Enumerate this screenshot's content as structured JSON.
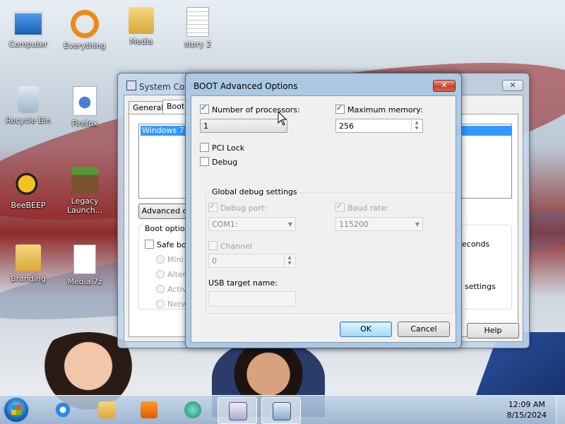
{
  "desktop": {
    "icons": [
      {
        "label": "Computer",
        "icon": "computer-icon"
      },
      {
        "label": "Everything",
        "icon": "everything-icon"
      },
      {
        "label": "Media",
        "icon": "folder-icon"
      },
      {
        "label": "story 2",
        "icon": "text-document-icon"
      },
      {
        "label": "Recycle Bin",
        "icon": "recycle-bin-icon"
      },
      {
        "label": "Firefox",
        "icon": "shortcut-file-icon"
      },
      {
        "label": "BeeBEEP",
        "icon": "bee-icon"
      },
      {
        "label": "Legacy Launch...",
        "icon": "minecraft-icon"
      },
      {
        "label": "Branding",
        "icon": "folder-icon"
      },
      {
        "label": "Media.7z",
        "icon": "blank-file-icon"
      }
    ]
  },
  "sysconfig": {
    "title": "System Conf",
    "close": "✕",
    "tabs": [
      "General",
      "Boot"
    ],
    "os_entry": "Windows 7 (C",
    "advanced_button": "Advanced o",
    "boot_options_legend": "Boot options",
    "safe_boot": "Safe bo",
    "radios": [
      "Mini",
      "Alter",
      "Activ",
      "Netw"
    ],
    "timeout_suffix": "econds",
    "settings_suffix": "settings",
    "help_button": "Help"
  },
  "dialog": {
    "title": "BOOT Advanced Options",
    "close": "✕",
    "num_processors": {
      "label": "Number of processors:",
      "checked": true,
      "value": "1"
    },
    "max_memory": {
      "label": "Maximum memory:",
      "checked": true,
      "value": "256"
    },
    "pci_lock": {
      "label": "PCI Lock",
      "checked": false
    },
    "debug": {
      "label": "Debug",
      "checked": false
    },
    "global_debug": {
      "legend": "Global debug settings",
      "debug_port": {
        "label": "Debug port:",
        "value": "COM1:"
      },
      "baud_rate": {
        "label": "Baud rate:",
        "value": "115200"
      },
      "channel": {
        "label": "Channel",
        "value": "0"
      },
      "usb_target": {
        "label": "USB target name:",
        "value": ""
      }
    },
    "ok": "OK",
    "cancel": "Cancel"
  },
  "taskbar": {
    "time": "12:09 AM",
    "date": "8/15/2024",
    "items": [
      "internet-explorer-icon",
      "file-explorer-icon",
      "media-player-icon",
      "app-icon",
      "on-screen-keyboard-icon",
      "msconfig-icon"
    ]
  },
  "colors": {
    "selection": "#3399ff",
    "close_red": "#c5432a",
    "default_button": "#3c7fb1"
  }
}
